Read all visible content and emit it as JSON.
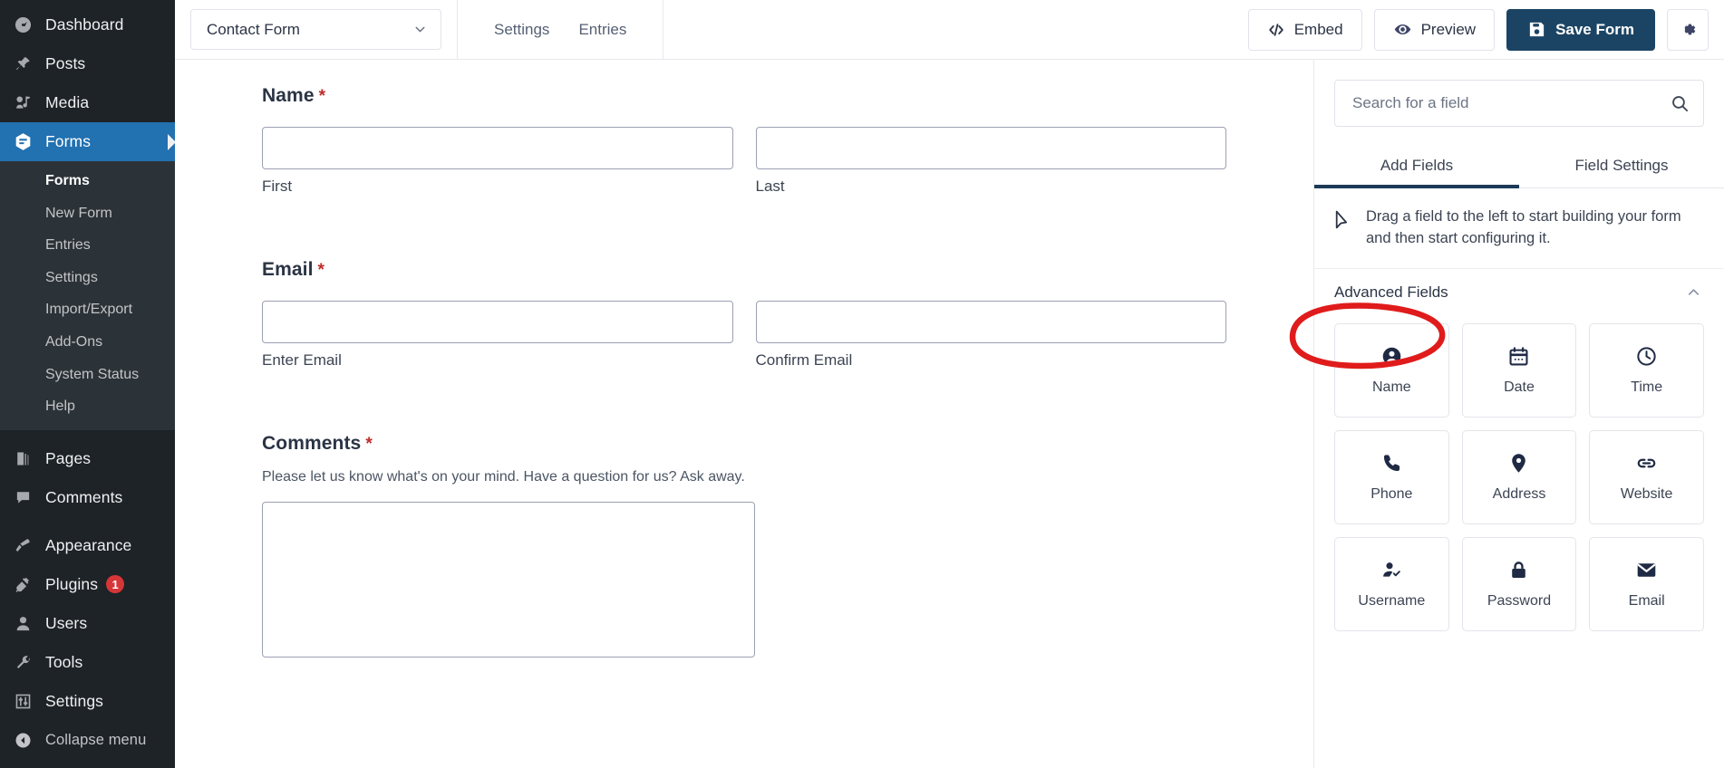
{
  "sidebar": {
    "items": [
      {
        "label": "Dashboard",
        "icon": "dashboard-icon",
        "current": false
      },
      {
        "label": "Posts",
        "icon": "pin-icon",
        "current": false
      },
      {
        "label": "Media",
        "icon": "media-icon",
        "current": false
      },
      {
        "label": "Forms",
        "icon": "forms-icon",
        "current": true
      }
    ],
    "submenu": [
      {
        "label": "Forms",
        "active": true
      },
      {
        "label": "New Form",
        "active": false
      },
      {
        "label": "Entries",
        "active": false
      },
      {
        "label": "Settings",
        "active": false
      },
      {
        "label": "Import/Export",
        "active": false
      },
      {
        "label": "Add-Ons",
        "active": false
      },
      {
        "label": "System Status",
        "active": false
      },
      {
        "label": "Help",
        "active": false
      }
    ],
    "items_lower": [
      {
        "label": "Pages",
        "icon": "pages-icon",
        "badge": ""
      },
      {
        "label": "Comments",
        "icon": "comments-icon",
        "badge": ""
      }
    ],
    "items_bottom": [
      {
        "label": "Appearance",
        "icon": "appearance-icon",
        "badge": ""
      },
      {
        "label": "Plugins",
        "icon": "plugins-icon",
        "badge": "1"
      },
      {
        "label": "Users",
        "icon": "users-icon",
        "badge": ""
      },
      {
        "label": "Tools",
        "icon": "tools-icon",
        "badge": ""
      },
      {
        "label": "Settings",
        "icon": "settings-icon",
        "badge": ""
      }
    ],
    "collapse_label": "Collapse menu",
    "collapse_icon": "chevron-left-circle-icon",
    "highlight_color": "#2271b1",
    "background_color": "#1d2327",
    "badge_color": "#d63638"
  },
  "toolbar": {
    "form_select_value": "Contact Form",
    "form_select_icon": "chevron-down-icon",
    "tabs": [
      {
        "label": "Settings"
      },
      {
        "label": "Entries"
      }
    ],
    "embed_label": "Embed",
    "embed_icon": "code-icon",
    "preview_label": "Preview",
    "preview_icon": "eye-icon",
    "save_label": "Save Form",
    "save_icon": "save-disk-icon",
    "save_button_color": "#1b4464",
    "settings_icon": "gear-icon"
  },
  "form": {
    "fields": [
      {
        "label": "Name",
        "required": "*",
        "description": "",
        "type": "two-column",
        "inputs": [
          {
            "sub_label": "First",
            "value": ""
          },
          {
            "sub_label": "Last",
            "value": ""
          }
        ]
      },
      {
        "label": "Email",
        "required": "*",
        "description": "",
        "type": "two-column",
        "inputs": [
          {
            "sub_label": "Enter Email",
            "value": ""
          },
          {
            "sub_label": "Confirm Email",
            "value": ""
          }
        ]
      },
      {
        "label": "Comments",
        "required": "*",
        "description": "Please let us know what's on your mind. Have a question for us? Ask away.",
        "type": "textarea",
        "inputs": [
          {
            "sub_label": "",
            "value": ""
          }
        ]
      }
    ]
  },
  "panel": {
    "search": {
      "placeholder": "Search for a field",
      "value": "",
      "icon": "search-icon"
    },
    "tabs": [
      {
        "label": "Add Fields",
        "active": true
      },
      {
        "label": "Field Settings",
        "active": false
      }
    ],
    "hint": {
      "icon": "cursor-arrow-icon",
      "text": "Drag a field to the left to start building your form and then start configuring it."
    },
    "section": {
      "title": "Advanced Fields",
      "collapse_icon": "chevron-up-icon",
      "annotated": true,
      "annotation_color": "#e01b1b"
    },
    "tiles": [
      {
        "label": "Name",
        "icon": "person-circle-icon"
      },
      {
        "label": "Date",
        "icon": "calendar-icon"
      },
      {
        "label": "Time",
        "icon": "clock-icon"
      },
      {
        "label": "Phone",
        "icon": "phone-icon"
      },
      {
        "label": "Address",
        "icon": "map-pin-icon"
      },
      {
        "label": "Website",
        "icon": "link-icon"
      },
      {
        "label": "Username",
        "icon": "person-check-icon"
      },
      {
        "label": "Password",
        "icon": "lock-icon"
      },
      {
        "label": "Email",
        "icon": "envelope-icon"
      }
    ]
  }
}
